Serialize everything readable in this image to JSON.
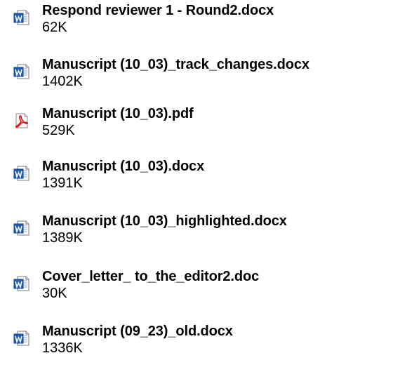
{
  "attachments": [
    {
      "name": "Respond reviewer 1 - Round2.docx",
      "size": "62K",
      "icon": "word-document-icon"
    },
    {
      "name": "Manuscript (10_03)_track_changes.docx",
      "size": "1402K",
      "icon": "word-document-icon"
    },
    {
      "name": "Manuscript (10_03).pdf",
      "size": "529K",
      "icon": "pdf-document-icon"
    },
    {
      "name": "Manuscript (10_03).docx",
      "size": "1391K",
      "icon": "word-document-icon"
    },
    {
      "name": "Manuscript (10_03)_highlighted.docx",
      "size": "1389K",
      "icon": "word-document-icon"
    },
    {
      "name": "Cover_letter_ to_the_editor2.doc",
      "size": "30K",
      "icon": "word-document-icon"
    },
    {
      "name": "Manuscript (09_23)_old.docx",
      "size": "1336K",
      "icon": "word-document-icon"
    }
  ],
  "colors": {
    "word_blue": "#1f5fbf",
    "pdf_red": "#d8231f",
    "text": "#000000",
    "background": "#ffffff"
  }
}
